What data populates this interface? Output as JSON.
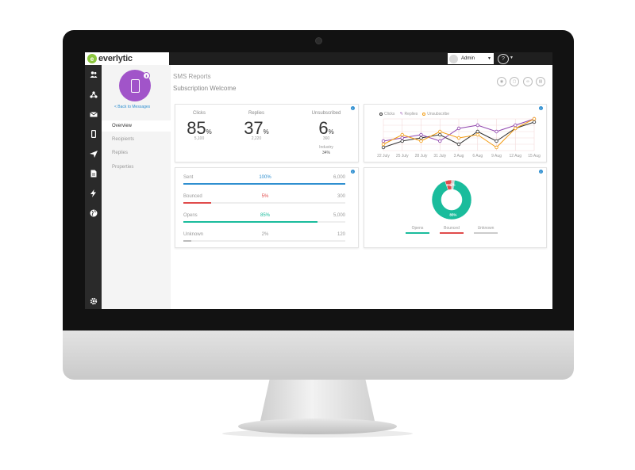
{
  "app": {
    "logo_text": "everlytic",
    "logo_glyph": "e"
  },
  "topbar": {
    "user_name": "Admin",
    "help_glyph": "?"
  },
  "nav_icons": [
    "contacts-icon",
    "network-icon",
    "mail-icon",
    "mobile-icon",
    "send-icon",
    "document-icon",
    "bolt-icon",
    "globe-icon",
    "gear-icon"
  ],
  "side": {
    "back_label": "< Back to Messages",
    "items": [
      {
        "label": "Overview"
      },
      {
        "label": "Recipients"
      },
      {
        "label": "Replies"
      },
      {
        "label": "Properties"
      }
    ]
  },
  "page": {
    "title": "SMS Reports",
    "subtitle": "Subscription Welcome"
  },
  "summary": {
    "clicks": {
      "label": "Clicks",
      "value": "85",
      "unit": "%",
      "count": "5,100"
    },
    "replies": {
      "label": "Replies",
      "value": "37",
      "unit": "%",
      "count": "2,220"
    },
    "unsubscribed": {
      "label": "Unsubscribed",
      "value": "6",
      "unit": "%",
      "count": "360",
      "industry_label": "Industry",
      "industry_value": "34%"
    }
  },
  "delivery": [
    {
      "label": "Sent",
      "pct": "100%",
      "total": "6,000",
      "fraction": 1.0,
      "color": "#2f8fd0"
    },
    {
      "label": "Bounced",
      "pct": "5%",
      "total": "300",
      "fraction": 0.17,
      "color": "#e04b4b"
    },
    {
      "label": "Opens",
      "pct": "85%",
      "total": "5,000",
      "fraction": 0.83,
      "color": "#1abc9c"
    },
    {
      "label": "Unknown",
      "pct": "2%",
      "total": "120",
      "fraction": 0.05,
      "color": "#bbbbbb"
    }
  ],
  "chart_data": [
    {
      "type": "line",
      "legend_position": "top-left",
      "grid": true,
      "categories": [
        "22 July",
        "25 July",
        "28 July",
        "31 July",
        "3 Aug",
        "6 Aug",
        "9 Aug",
        "12 Aug",
        "15 Aug"
      ],
      "ylim": [
        0,
        10
      ],
      "series": [
        {
          "name": "Clicks",
          "color": "#333333",
          "values": [
            1,
            3,
            4,
            5,
            2,
            6,
            3,
            7,
            9
          ]
        },
        {
          "name": "Replies",
          "color": "#8e44ad",
          "values": [
            3,
            4,
            5,
            3,
            7,
            8,
            6,
            8,
            10
          ]
        },
        {
          "name": "Unsubscribe",
          "color": "#f39c12",
          "values": [
            2,
            5,
            3,
            6,
            4,
            5,
            1,
            7,
            10
          ]
        }
      ]
    },
    {
      "type": "pie",
      "categories": [
        "Opens",
        "Bounced",
        "Unknown"
      ],
      "values": [
        85,
        5,
        2
      ],
      "data_labels": [
        "85%",
        "5%",
        "2%"
      ],
      "colors": [
        "#1abc9c",
        "#e04b4b",
        "#cccccc"
      ]
    }
  ]
}
